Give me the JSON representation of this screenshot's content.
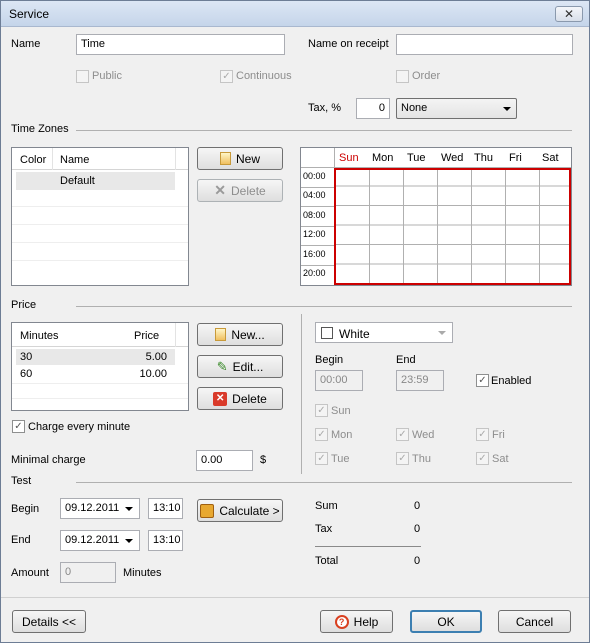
{
  "window": {
    "title": "Service",
    "close_glyph": "✕"
  },
  "general": {
    "name_label": "Name",
    "name_value": "Time",
    "receipt_label": "Name on receipt",
    "receipt_value": "",
    "public_label": "Public",
    "continuous_label": "Continuous",
    "order_label": "Order",
    "tax_label": "Tax, %",
    "tax_value": "0",
    "tax_select": "None"
  },
  "timezones": {
    "section": "Time Zones",
    "columns": [
      "Color",
      "Name"
    ],
    "rows": [
      {
        "color": "",
        "name": "Default"
      }
    ],
    "new_label": "New",
    "delete_label": "Delete",
    "days": [
      "Sun",
      "Mon",
      "Tue",
      "Wed",
      "Thu",
      "Fri",
      "Sat"
    ],
    "hours": [
      "00:00",
      "04:00",
      "08:00",
      "12:00",
      "16:00",
      "20:00"
    ]
  },
  "price": {
    "section": "Price",
    "columns": [
      "Minutes",
      "Price"
    ],
    "rows": [
      {
        "minutes": "30",
        "price": "5.00"
      },
      {
        "minutes": "60",
        "price": "10.00"
      }
    ],
    "new_label": "New...",
    "edit_label": "Edit...",
    "delete_label": "Delete",
    "charge_every_minute": "Charge every minute",
    "minimal_label": "Minimal charge",
    "minimal_value": "0.00",
    "currency": "$",
    "color_value": "White",
    "begin_label": "Begin",
    "begin_value": "00:00",
    "end_label": "End",
    "end_value": "23:59",
    "enabled_label": "Enabled",
    "day_labels": {
      "sun": "Sun",
      "mon": "Mon",
      "wed": "Wed",
      "fri": "Fri",
      "tue": "Tue",
      "thu": "Thu",
      "sat": "Sat"
    }
  },
  "test": {
    "section": "Test",
    "begin_label": "Begin",
    "begin_date": "09.12.2011",
    "begin_time": "13:10",
    "end_label": "End",
    "end_date": "09.12.2011",
    "end_time": "13:10",
    "calculate_label": "Calculate >",
    "amount_label": "Amount",
    "amount_value": "0",
    "minutes_label": "Minutes",
    "sum_label": "Sum",
    "sum_value": "0",
    "tax_label": "Tax",
    "tax_value": "0",
    "total_label": "Total",
    "total_value": "0"
  },
  "footer": {
    "details_label": "Details <<",
    "help_label": "Help",
    "ok_label": "OK",
    "cancel_label": "Cancel"
  },
  "colors": {
    "title_bg": "#c5d5ea",
    "sunday": "#cc0000",
    "grid_border": "#cc0000",
    "ok_border": "#3c7fb1"
  }
}
